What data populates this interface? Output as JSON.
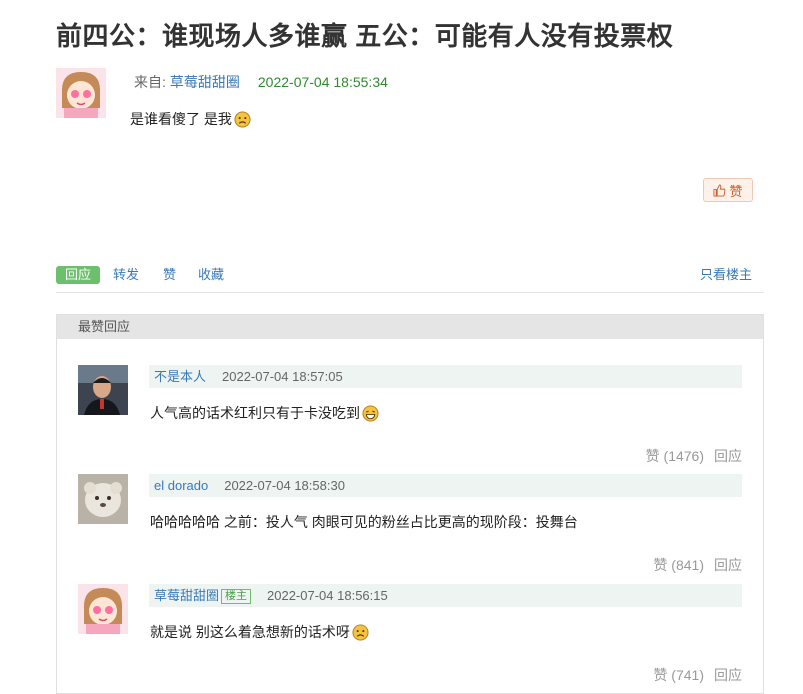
{
  "post": {
    "title": "前四公：谁现场人多谁赢 五公：可能有人没有投票权",
    "from_label": "来自:",
    "author": "草莓甜甜圈",
    "time": "2022-07-04 18:55:34",
    "body": "是谁看傻了 是我",
    "like_label": "赞"
  },
  "actions": {
    "reply": "回应",
    "forward": "转发",
    "like": "赞",
    "collect": "收藏",
    "only_op": "只看楼主"
  },
  "top_replies": {
    "header": "最赞回应",
    "items": [
      {
        "author": "不是本人",
        "badge": "",
        "time": "2022-07-04 18:57:05",
        "text": "人气高的话术红利只有于卡没吃到",
        "likes": "赞 (1476)",
        "reply": "回应",
        "emoji": "grin-emoji"
      },
      {
        "author": "el dorado",
        "badge": "",
        "time": "2022-07-04 18:58:30",
        "text": "哈哈哈哈哈 之前：投人气 肉眼可见的粉丝占比更高的现阶段：投舞台",
        "likes": "赞 (841)",
        "reply": "回应",
        "emoji": ""
      },
      {
        "author": "草莓甜甜圈",
        "badge": "楼主",
        "time": "2022-07-04 18:56:15",
        "text": "就是说 别这么着急想新的话术呀",
        "likes": "赞 (741)",
        "reply": "回应",
        "emoji": "sad-emoji"
      }
    ]
  },
  "colors": {
    "accent_green": "#6cbf6c",
    "link_blue": "#3a7ab8",
    "time_green": "#2e8b2e"
  }
}
